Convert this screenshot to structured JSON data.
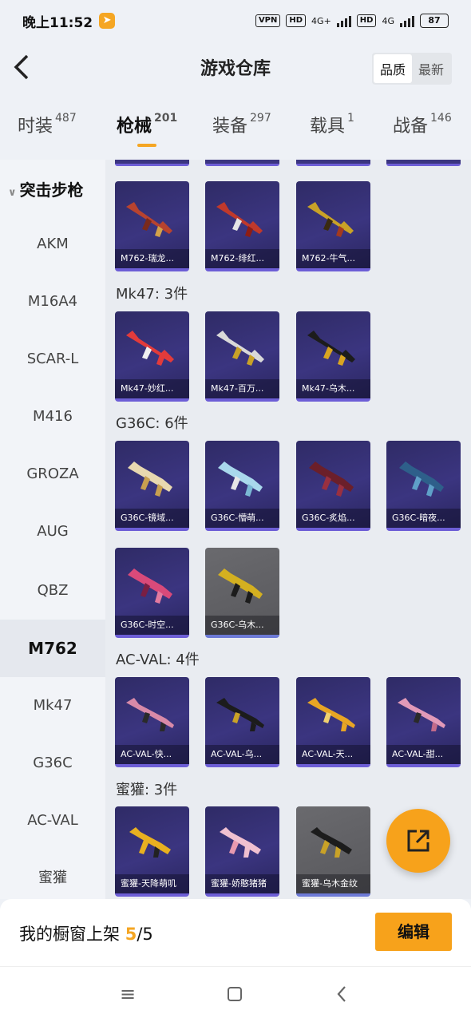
{
  "status": {
    "time": "晚上11:52",
    "vpn": "VPN",
    "hd1": "HD",
    "net1": "4G+",
    "hd2": "HD",
    "net2": "4G",
    "battery": "87"
  },
  "header": {
    "title": "游戏仓库",
    "sort_options": [
      "品质",
      "最新"
    ]
  },
  "tabs": [
    {
      "label": "时装",
      "count": "487"
    },
    {
      "label": "枪械",
      "count": "201"
    },
    {
      "label": "装备",
      "count": "297"
    },
    {
      "label": "载具",
      "count": "1"
    },
    {
      "label": "战备",
      "count": "146"
    }
  ],
  "sidebar": {
    "group": "突击步枪",
    "items": [
      "AKM",
      "M16A4",
      "SCAR-L",
      "M416",
      "GROZA",
      "AUG",
      "QBZ",
      "M762",
      "Mk47",
      "G36C",
      "AC-VAL",
      "蜜獾"
    ],
    "active": "M762"
  },
  "sections": [
    {
      "title": "Mk47: 3件"
    },
    {
      "title": "G36C: 6件"
    },
    {
      "title": "AC-VAL: 4件"
    },
    {
      "title": "蜜獾: 3件"
    }
  ],
  "cards": {
    "m762": [
      "M762-瑞龙...",
      "M762-绯红...",
      "M762-牛气..."
    ],
    "mk47": [
      "Mk47-妙红...",
      "Mk47-百万...",
      "Mk47-乌木..."
    ],
    "g36c": [
      "G36C-镜域...",
      "G36C-懵萌...",
      "G36C-炙焰...",
      "G36C-暗夜...",
      "G36C-时空...",
      "G36C-乌木..."
    ],
    "acval": [
      "AC-VAL-快...",
      "AC-VAL-乌...",
      "AC-VAL-天...",
      "AC-VAL-甜..."
    ],
    "honeybadger": [
      "蜜獾-天降萌叽",
      "蜜獾-娇憨猪猪",
      "蜜獾-乌木金纹"
    ]
  },
  "bottom": {
    "text": "我的橱窗上架",
    "current": "5",
    "total": "/5",
    "edit_label": "编辑"
  },
  "colors": {
    "accent": "#f7a21b",
    "card_bg": "#3b3580",
    "card_border": "#6d5ed6"
  }
}
